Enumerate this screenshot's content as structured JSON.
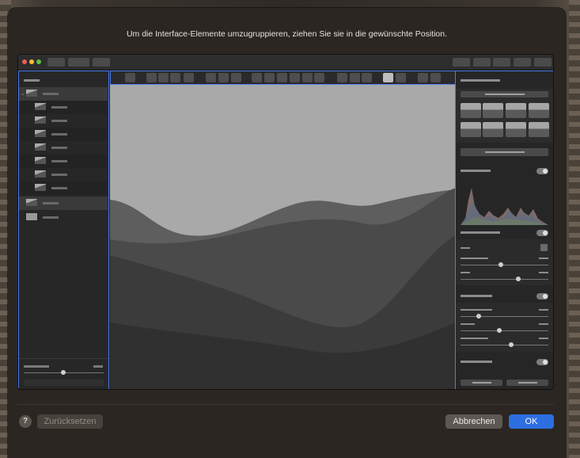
{
  "dialog": {
    "instruction": "Um die Interface-Elemente umzugruppieren, ziehen Sie sie in die gewünschte Position."
  },
  "buttons": {
    "help_label": "?",
    "reset_label": "Zurücksetzen",
    "cancel_label": "Abbrechen",
    "ok_label": "OK"
  },
  "colors": {
    "accent": "#2d6fe0",
    "selection_outline": "#4b7bec"
  },
  "icons": [
    "close-icon",
    "minimize-icon",
    "zoom-icon",
    "help-icon"
  ]
}
